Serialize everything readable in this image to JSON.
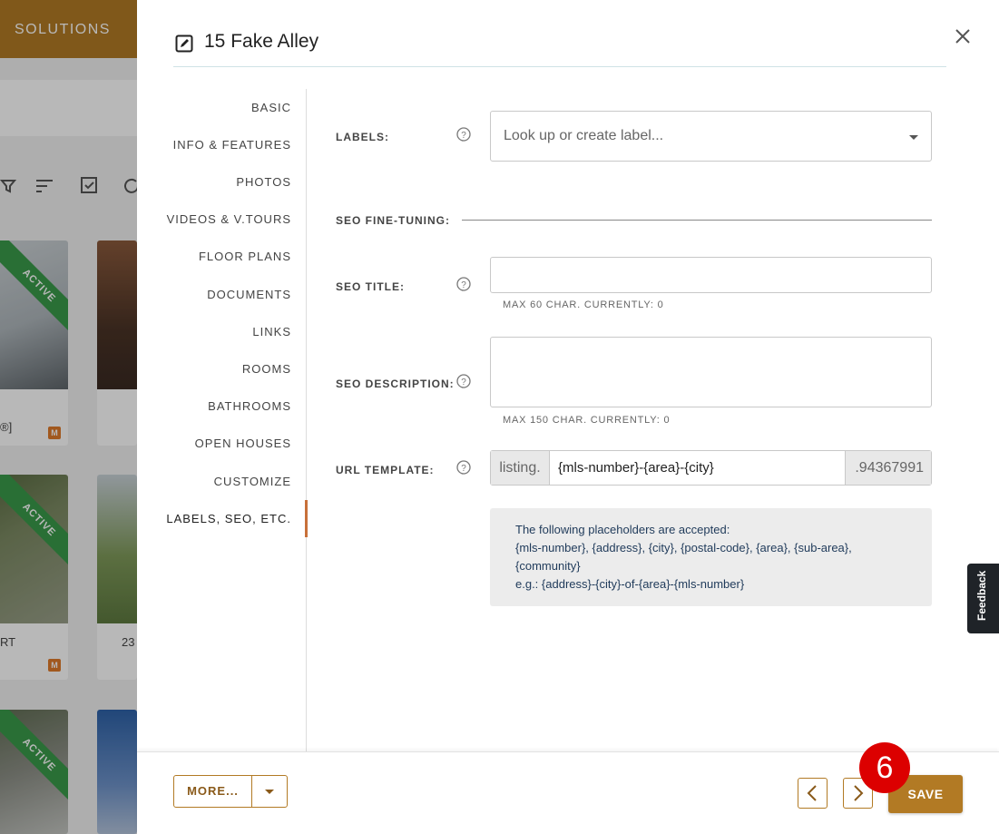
{
  "background": {
    "nav_label": "SOLUTIONS",
    "cards": [
      {
        "status": "ACTIVE",
        "caption": "®]",
        "badge": "M"
      },
      {
        "status": "",
        "caption": "",
        "badge": ""
      },
      {
        "status": "ACTIVE",
        "caption": "RT",
        "badge": "M"
      },
      {
        "status": "",
        "caption": "23",
        "badge": ""
      },
      {
        "status": "ACTIVE",
        "caption": "",
        "badge": ""
      },
      {
        "status": "",
        "caption": "",
        "badge": ""
      }
    ]
  },
  "modal": {
    "title": "15 Fake Alley",
    "close_icon": "close-icon"
  },
  "sidenav": {
    "items": [
      {
        "label": "BASIC"
      },
      {
        "label": "INFO & FEATURES"
      },
      {
        "label": "PHOTOS"
      },
      {
        "label": "VIDEOS & V.TOURS"
      },
      {
        "label": "FLOOR PLANS"
      },
      {
        "label": "DOCUMENTS"
      },
      {
        "label": "LINKS"
      },
      {
        "label": "ROOMS"
      },
      {
        "label": "BATHROOMS"
      },
      {
        "label": "OPEN HOUSES"
      },
      {
        "label": "CUSTOMIZE"
      },
      {
        "label": "LABELS, SEO, ETC."
      }
    ],
    "active": "LABELS, SEO, ETC."
  },
  "form": {
    "labels": {
      "label": "LABELS:",
      "placeholder": "Look up or create label..."
    },
    "seo_section": "SEO FINE-TUNING:",
    "seo_title": {
      "label": "SEO TITLE:",
      "value": "",
      "hint": "MAX 60 CHAR. CURRENTLY: 0"
    },
    "seo_description": {
      "label": "SEO DESCRIPTION:",
      "value": "",
      "hint": "MAX 150 CHAR. CURRENTLY: 0"
    },
    "url_template": {
      "label": "URL TEMPLATE:",
      "prefix": "listing.",
      "value": "{mls-number}-{area}-{city}",
      "suffix": ".94367991"
    },
    "info": {
      "line1": "The following placeholders are accepted:",
      "line2": "{mls-number}, {address}, {city}, {postal-code}, {area}, {sub-area},",
      "line3": "{community}",
      "line4": "e.g.: {address}-{city}-of-{area}-{mls-number}"
    }
  },
  "footer": {
    "more_label": "MORE...",
    "save_label": "SAVE",
    "step_badge": "6"
  },
  "feedback_label": "Feedback",
  "colors": {
    "accent": "#b27a24",
    "active_bar": "#c8703a",
    "ribbon": "#3a9a4a",
    "badge": "#dc0000"
  }
}
